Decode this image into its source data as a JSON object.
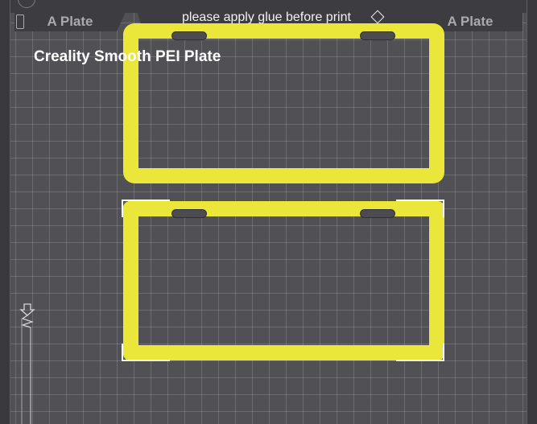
{
  "tabs": {
    "left_label": "A Plate",
    "right_label": "A Plate"
  },
  "notice": {
    "text": "please apply glue before print",
    "icon": "eraser-icon"
  },
  "plate": {
    "name": "Creality Smooth PEI Plate"
  },
  "colors": {
    "background": "#505055",
    "grid": "#6a6a70",
    "object": "#ebe63a",
    "selection": "#ffffff",
    "panel": "#3d3d41"
  },
  "objects": [
    {
      "name": "license-plate-frame-1",
      "selected": false
    },
    {
      "name": "license-plate-frame-2",
      "selected": true
    }
  ]
}
